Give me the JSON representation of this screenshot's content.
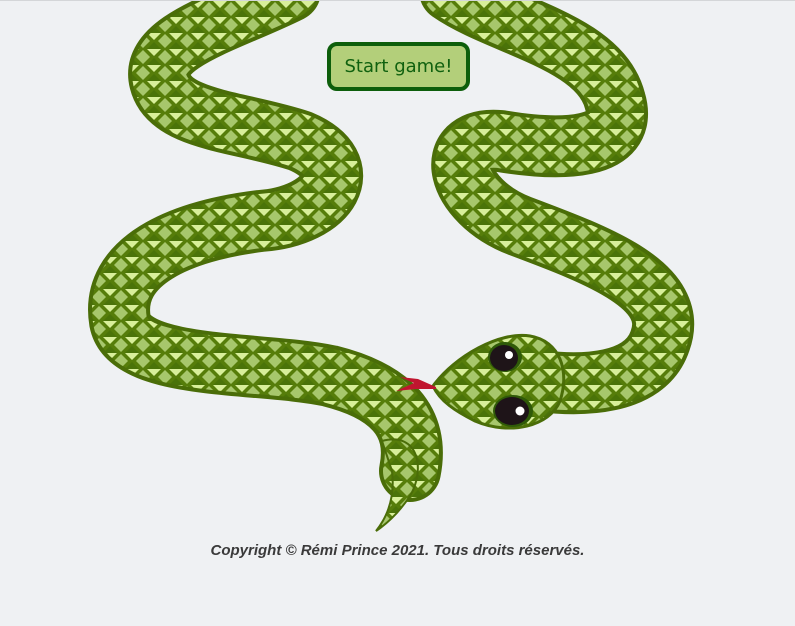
{
  "game": {
    "start_button_label": "Start game!"
  },
  "footer": {
    "copyright": "Copyright © Rémi Prince 2021. Tous droits réservés."
  },
  "colors": {
    "background": "#eff1f3",
    "snake_body": "#567d0a",
    "snake_outline": "#4a6d08",
    "scale_dark": "#3f6b08",
    "scale_mid": "#a7c76c",
    "scale_light": "#d8ef9a",
    "tongue": "#c0152f",
    "button_fill": "#b3cf7a",
    "button_border": "#0d5e0b",
    "button_text": "#10610f"
  },
  "icons": {
    "snake": "snake-illustration"
  }
}
